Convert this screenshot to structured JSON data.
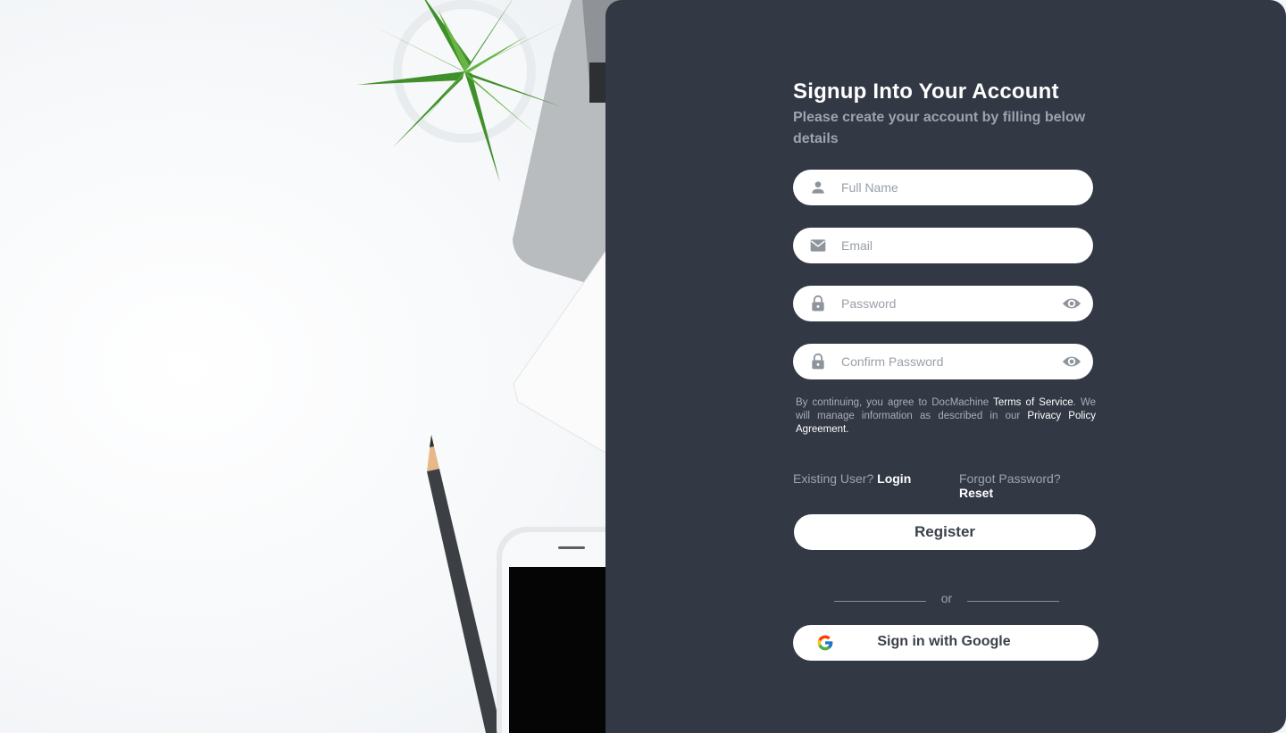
{
  "header": {
    "title": "Signup Into Your Account",
    "subtitle": "Please create your account by filling below details"
  },
  "fields": {
    "full_name": {
      "placeholder": "Full Name",
      "icon": "person-icon"
    },
    "email": {
      "placeholder": "Email",
      "icon": "mail-icon"
    },
    "password": {
      "placeholder": "Password",
      "icon": "lock-icon"
    },
    "confirm_password": {
      "placeholder": "Confirm Password",
      "icon": "lock-icon"
    }
  },
  "terms": {
    "prefix": "By continuing, you agree to DocMachine ",
    "terms_link": "Terms of Service",
    "middle": ". We will manage information as described in our ",
    "privacy_link": "Privacy Policy Agreement."
  },
  "links": {
    "existing_user": "Existing User?",
    "login": "Login",
    "forgot_password": "Forgot Password?",
    "reset": "Reset"
  },
  "actions": {
    "register": "Register",
    "or": "or",
    "google": "Sign in with Google"
  },
  "colors": {
    "panel": "#323844",
    "accent_text": "#ffffff",
    "muted_text": "#9ea4ae"
  }
}
